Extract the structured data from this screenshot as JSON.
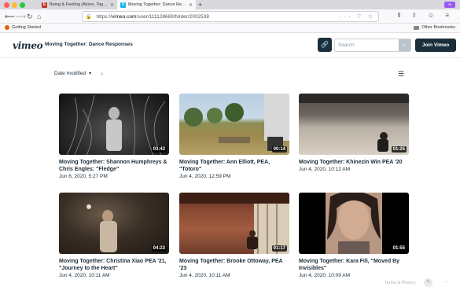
{
  "browser": {
    "tabs": [
      {
        "label": "Being & Feeling (Alone, Togeth",
        "favicon": "E",
        "favicon_color": "#c0392b"
      },
      {
        "label": "Moving Together: Dance Respons",
        "favicon": "V",
        "favicon_color": "#1ab7ea"
      }
    ],
    "url_domain": "vimeo.com",
    "url_prefix": "https://",
    "url_path": "/user/111128669/folder/2002538",
    "bookmarks_left": "Getting Started",
    "bookmarks_right": "Other Bookmarks"
  },
  "header": {
    "logo": "vimeo",
    "title": "Moving Together: Dance Responses",
    "search_placeholder": "Search",
    "join_label": "Join Vimeo"
  },
  "sort": {
    "label": "Date modified"
  },
  "videos": [
    {
      "title": "Moving Together: Shannon Humphreys & Chris Engles: \"Fledge\"",
      "date": "Jun 6, 2020, 5:27 PM",
      "duration": "03:43"
    },
    {
      "title": "Moving Together: Ann Elliott, PEA, \"Totoro\"",
      "date": "Jun 4, 2020, 12:59 PM",
      "duration": "00:14"
    },
    {
      "title": "Moving Together: Khinezin Win PEA '20",
      "date": "Jun 4, 2020, 10:12 AM",
      "duration": "01:25"
    },
    {
      "title": "Moving Together: Christina Xiao PEA '21, \"Journey to the Heart\"",
      "date": "Jun 4, 2020, 10:11 AM",
      "duration": "04:23"
    },
    {
      "title": "Moving Together: Brooke Ottoway, PEA '23",
      "date": "Jun 4, 2020, 10:11 AM",
      "duration": "01:17"
    },
    {
      "title": "Moving Together: Kara Fili, \"Moved By Invisibles\"",
      "date": "Jun 4, 2020, 10:09 AM",
      "duration": "01:55"
    }
  ],
  "footer": {
    "text": "Terms & Privacy"
  }
}
